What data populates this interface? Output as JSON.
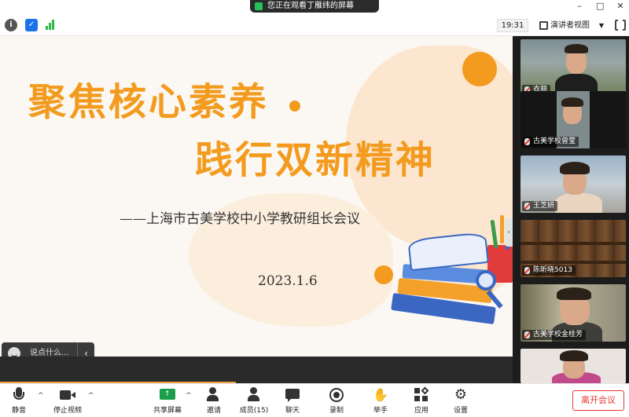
{
  "window": {
    "share_notice": "您正在观看丁雁纬的屏幕",
    "controls": [
      "–",
      "□",
      "✕"
    ]
  },
  "toolbar": {
    "time": "19:31",
    "view_mode": "演讲者视图",
    "info_icon": "info-icon",
    "shield_icon": "shield-icon",
    "signal_icon": "signal-icon"
  },
  "slide": {
    "title_line1": "聚焦核心素养",
    "title_line2": "践行双新精神",
    "subtitle": "——上海市古美学校中小学教研组长会议",
    "date": "2023.1.6",
    "accent_color": "#f39b1f"
  },
  "chat": {
    "placeholder": "说点什么..."
  },
  "participants": [
    {
      "name": "衣丽"
    },
    {
      "name": "古美学校曾莹"
    },
    {
      "name": "王芝妍"
    },
    {
      "name": "陈昕晓5013"
    },
    {
      "name": "古美学校金桂芳"
    },
    {
      "name": ""
    }
  ],
  "controls": {
    "mute": "静音",
    "stop_video": "停止视频",
    "share_screen": "共享屏幕",
    "invite": "邀请",
    "members": "成员(15)",
    "chat": "聊天",
    "record": "录制",
    "raise_hand": "举手",
    "apps": "应用",
    "settings": "设置",
    "leave": "离开会议"
  }
}
